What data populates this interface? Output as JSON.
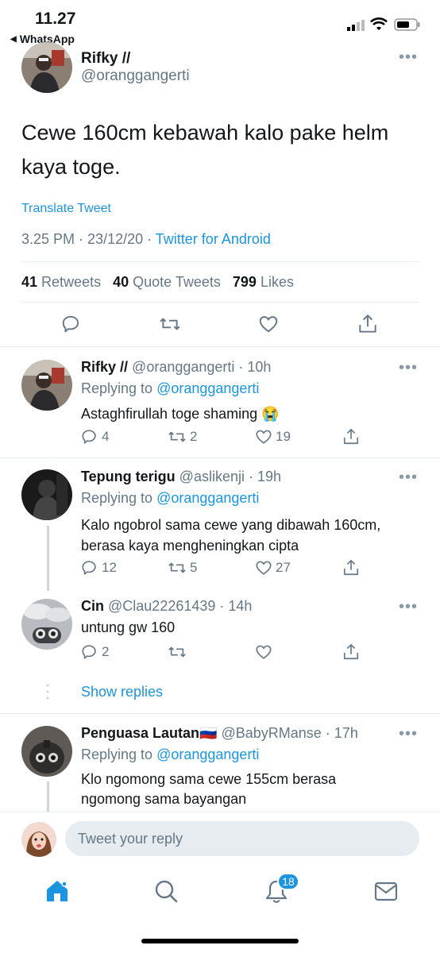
{
  "status_bar": {
    "time": "11.27",
    "back_app": "WhatsApp"
  },
  "main_tweet": {
    "name": "Rifky //",
    "handle": "@oranggangerti",
    "text": "Cewe 160cm kebawah kalo pake helm kaya toge.",
    "translate": "Translate Tweet",
    "time": "3.25 PM",
    "date": "23/12/20",
    "source": "Twitter for Android",
    "retweets": "41",
    "retweets_label": "Retweets",
    "quotes": "40",
    "quotes_label": "Quote Tweets",
    "likes": "799",
    "likes_label": "Likes"
  },
  "replies": [
    {
      "name": "Rifky //",
      "handle": "@oranggangerti",
      "time": "10h",
      "replying_to_label": "Replying to",
      "replying_to": "@oranggangerti",
      "text": "Astaghfirullah toge shaming 😭",
      "reply_count": "4",
      "retweet_count": "2",
      "like_count": "19"
    },
    {
      "name": "Tepung terigu",
      "handle": "@aslikenji",
      "time": "19h",
      "replying_to_label": "Replying to",
      "replying_to": "@oranggangerti",
      "text": "Kalo ngobrol sama cewe yang dibawah 160cm, berasa kaya mengheningkan cipta",
      "reply_count": "12",
      "retweet_count": "5",
      "like_count": "27"
    },
    {
      "name": "Cin",
      "handle": "@Clau22261439",
      "time": "14h",
      "text": "untung gw 160",
      "reply_count": "2"
    },
    {
      "name": "Penguasa Lautan🇷🇺",
      "handle": "@BabyRManse",
      "time": "17h",
      "replying_to_label": "Replying to",
      "replying_to": "@oranggangerti",
      "text": "Klo ngomong sama cewe 155cm berasa ngomong sama bayangan"
    }
  ],
  "show_replies": "Show replies",
  "composer": {
    "placeholder": "Tweet your reply"
  },
  "tab_bar": {
    "notification_count": "18"
  },
  "icons": {
    "reply": "reply-icon",
    "retweet": "retweet-icon",
    "like": "heart-icon",
    "share": "share-icon",
    "home": "home-icon",
    "search": "search-icon",
    "notifications": "bell-icon",
    "messages": "mail-icon"
  },
  "colors": {
    "accent": "#1b95e0",
    "muted": "#657786",
    "divider": "#e6ecf0"
  }
}
